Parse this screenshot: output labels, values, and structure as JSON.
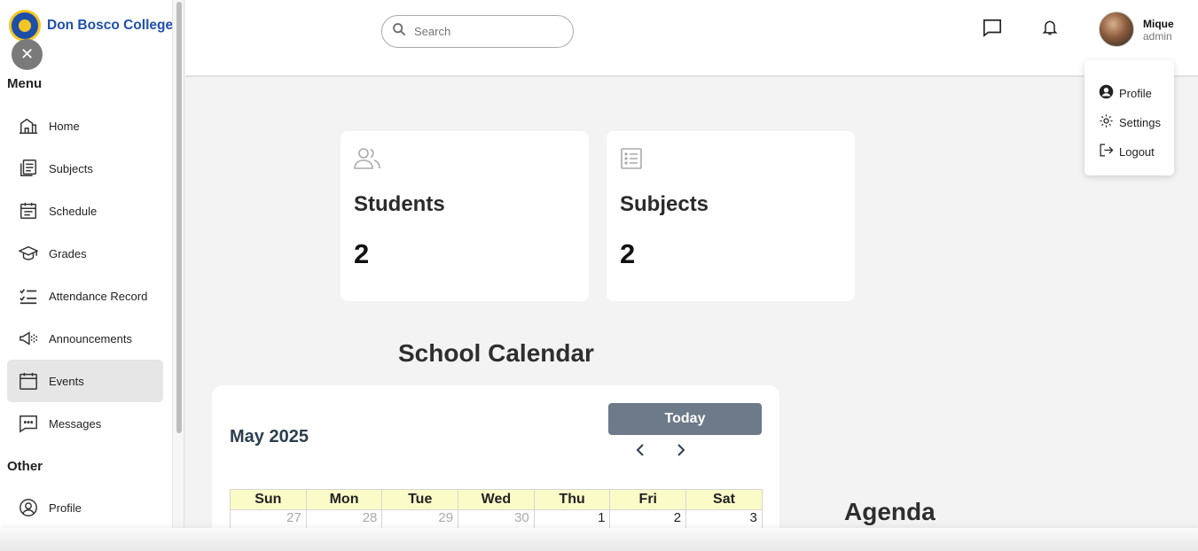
{
  "brand": {
    "name": "Don Bosco College"
  },
  "sidebar": {
    "menu_title": "Menu",
    "other_title": "Other",
    "items": [
      {
        "label": "Home",
        "icon": "home-icon"
      },
      {
        "label": "Subjects",
        "icon": "subjects-icon"
      },
      {
        "label": "Schedule",
        "icon": "schedule-icon"
      },
      {
        "label": "Grades",
        "icon": "grades-icon"
      },
      {
        "label": "Attendance Record",
        "icon": "attendance-icon"
      },
      {
        "label": "Announcements",
        "icon": "megaphone-icon"
      },
      {
        "label": "Events",
        "icon": "calendar-icon",
        "active": true
      },
      {
        "label": "Messages",
        "icon": "message-icon"
      }
    ],
    "other_items": [
      {
        "label": "Profile",
        "icon": "user-circle-icon"
      }
    ]
  },
  "header": {
    "search": {
      "placeholder": "Search"
    },
    "user": {
      "name": "Mique",
      "role": "admin"
    }
  },
  "user_menu": {
    "items": [
      {
        "label": "Profile",
        "icon": "user-circle-icon"
      },
      {
        "label": "Settings",
        "icon": "gear-icon"
      },
      {
        "label": "Logout",
        "icon": "logout-icon"
      }
    ]
  },
  "stats": [
    {
      "title": "Students",
      "value": "2",
      "icon": "users-icon"
    },
    {
      "title": "Subjects",
      "value": "2",
      "icon": "list-icon"
    }
  ],
  "calendar": {
    "heading": "School Calendar",
    "month": "May 2025",
    "today_label": "Today",
    "weekdays": [
      "Sun",
      "Mon",
      "Tue",
      "Wed",
      "Thu",
      "Fri",
      "Sat"
    ],
    "first_week": [
      "27",
      "28",
      "29",
      "30",
      "1",
      "2",
      "3"
    ]
  },
  "agenda": {
    "heading": "Agenda"
  },
  "colors": {
    "brand": "#1f4fae",
    "today_button": "#6c7a89",
    "weekday_header": "#fbfbc8"
  }
}
